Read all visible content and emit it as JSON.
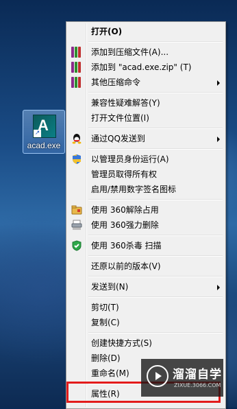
{
  "desktop": {
    "icon_label": "acad.exe"
  },
  "menu": {
    "items": [
      {
        "label": "打开(O)",
        "icon": "",
        "submenu": false
      },
      {
        "label": "添加到压缩文件(A)...",
        "icon": "winrar-icon",
        "submenu": false
      },
      {
        "label": "添加到 \"acad.exe.zip\" (T)",
        "icon": "winrar-icon",
        "submenu": false
      },
      {
        "label": "其他压缩命令",
        "icon": "winrar-icon",
        "submenu": true
      },
      {
        "label": "兼容性疑难解答(Y)",
        "icon": "",
        "submenu": false
      },
      {
        "label": "打开文件位置(I)",
        "icon": "",
        "submenu": false
      },
      {
        "label": "通过QQ发送到",
        "icon": "qq-icon",
        "submenu": true
      },
      {
        "label": "以管理员身份运行(A)",
        "icon": "uac-shield-icon",
        "submenu": false
      },
      {
        "label": "管理员取得所有权",
        "icon": "",
        "submenu": false
      },
      {
        "label": "启用/禁用数字签名图标",
        "icon": "",
        "submenu": false
      },
      {
        "label": "使用 360解除占用",
        "icon": "360-unlock-icon",
        "submenu": false
      },
      {
        "label": "使用 360强力删除",
        "icon": "shredder-icon",
        "submenu": false
      },
      {
        "label": "使用 360杀毒 扫描",
        "icon": "360-antivirus-icon",
        "submenu": false
      },
      {
        "label": "还原以前的版本(V)",
        "icon": "",
        "submenu": false
      },
      {
        "label": "发送到(N)",
        "icon": "",
        "submenu": true
      },
      {
        "label": "剪切(T)",
        "icon": "",
        "submenu": false
      },
      {
        "label": "复制(C)",
        "icon": "",
        "submenu": false
      },
      {
        "label": "创建快捷方式(S)",
        "icon": "",
        "submenu": false
      },
      {
        "label": "删除(D)",
        "icon": "",
        "submenu": false
      },
      {
        "label": "重命名(M)",
        "icon": "",
        "submenu": false
      },
      {
        "label": "属性(R)",
        "icon": "",
        "submenu": false
      }
    ]
  },
  "watermark": {
    "title": "溜溜自学",
    "url": "ZIXUE.3066.COM"
  },
  "colors": {
    "highlight_border": "#e31b1b",
    "menu_bg": "#f0f0f0"
  }
}
